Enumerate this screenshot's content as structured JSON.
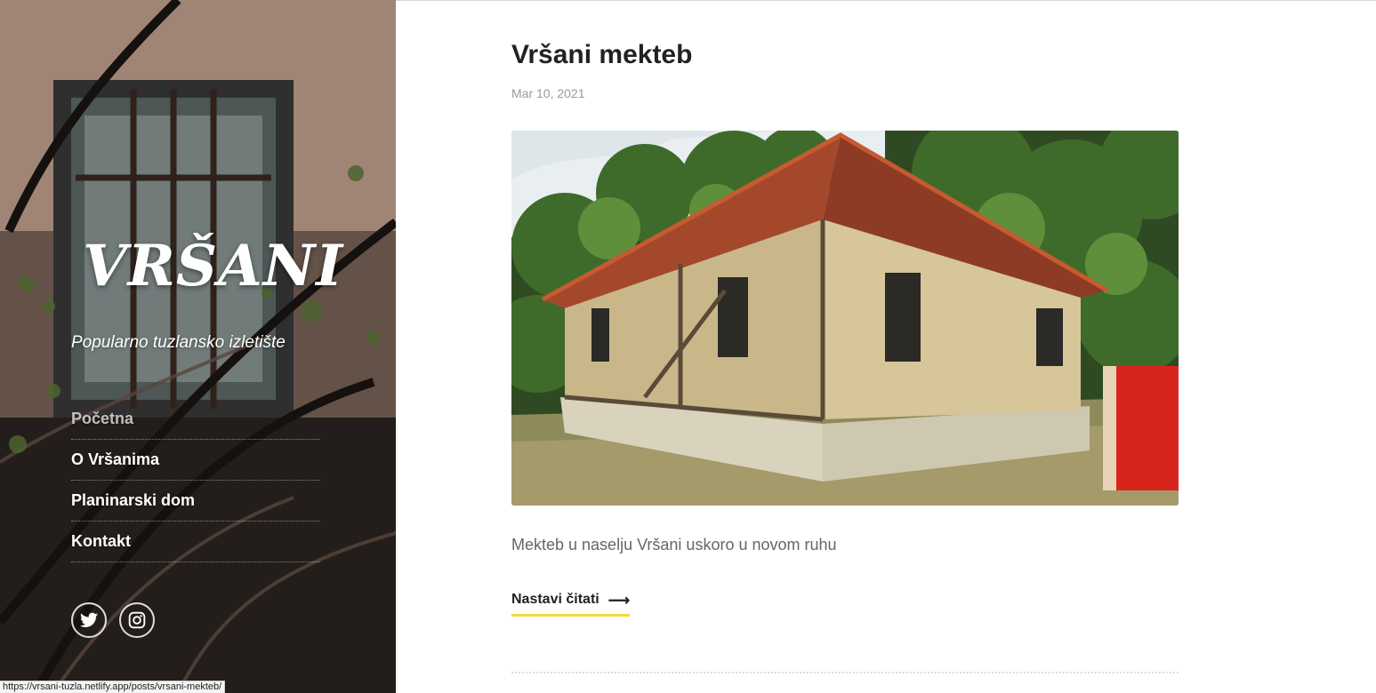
{
  "sidebar": {
    "title": "VRŠANI",
    "tagline": "Popularno tuzlansko izletište",
    "nav": [
      {
        "label": "Početna",
        "active": true
      },
      {
        "label": "O Vršanima",
        "active": false
      },
      {
        "label": "Planinarski dom",
        "active": false
      },
      {
        "label": "Kontakt",
        "active": false
      }
    ],
    "social": [
      "twitter-icon",
      "instagram-icon"
    ]
  },
  "post": {
    "title": "Vršani mekteb",
    "date": "Mar 10, 2021",
    "excerpt": "Mekteb u naselju Vršani uskoro u novom ruhu",
    "read_more": "Nastavi čitati",
    "read_more_arrow": "⟶"
  },
  "status_bar": {
    "url": "https://vrsani-tuzla.netlify.app/posts/vrsani-mekteb/"
  },
  "colors": {
    "accent_underline": "#f6d93b",
    "text_dark": "#222222",
    "text_muted": "#9a9a9a"
  }
}
